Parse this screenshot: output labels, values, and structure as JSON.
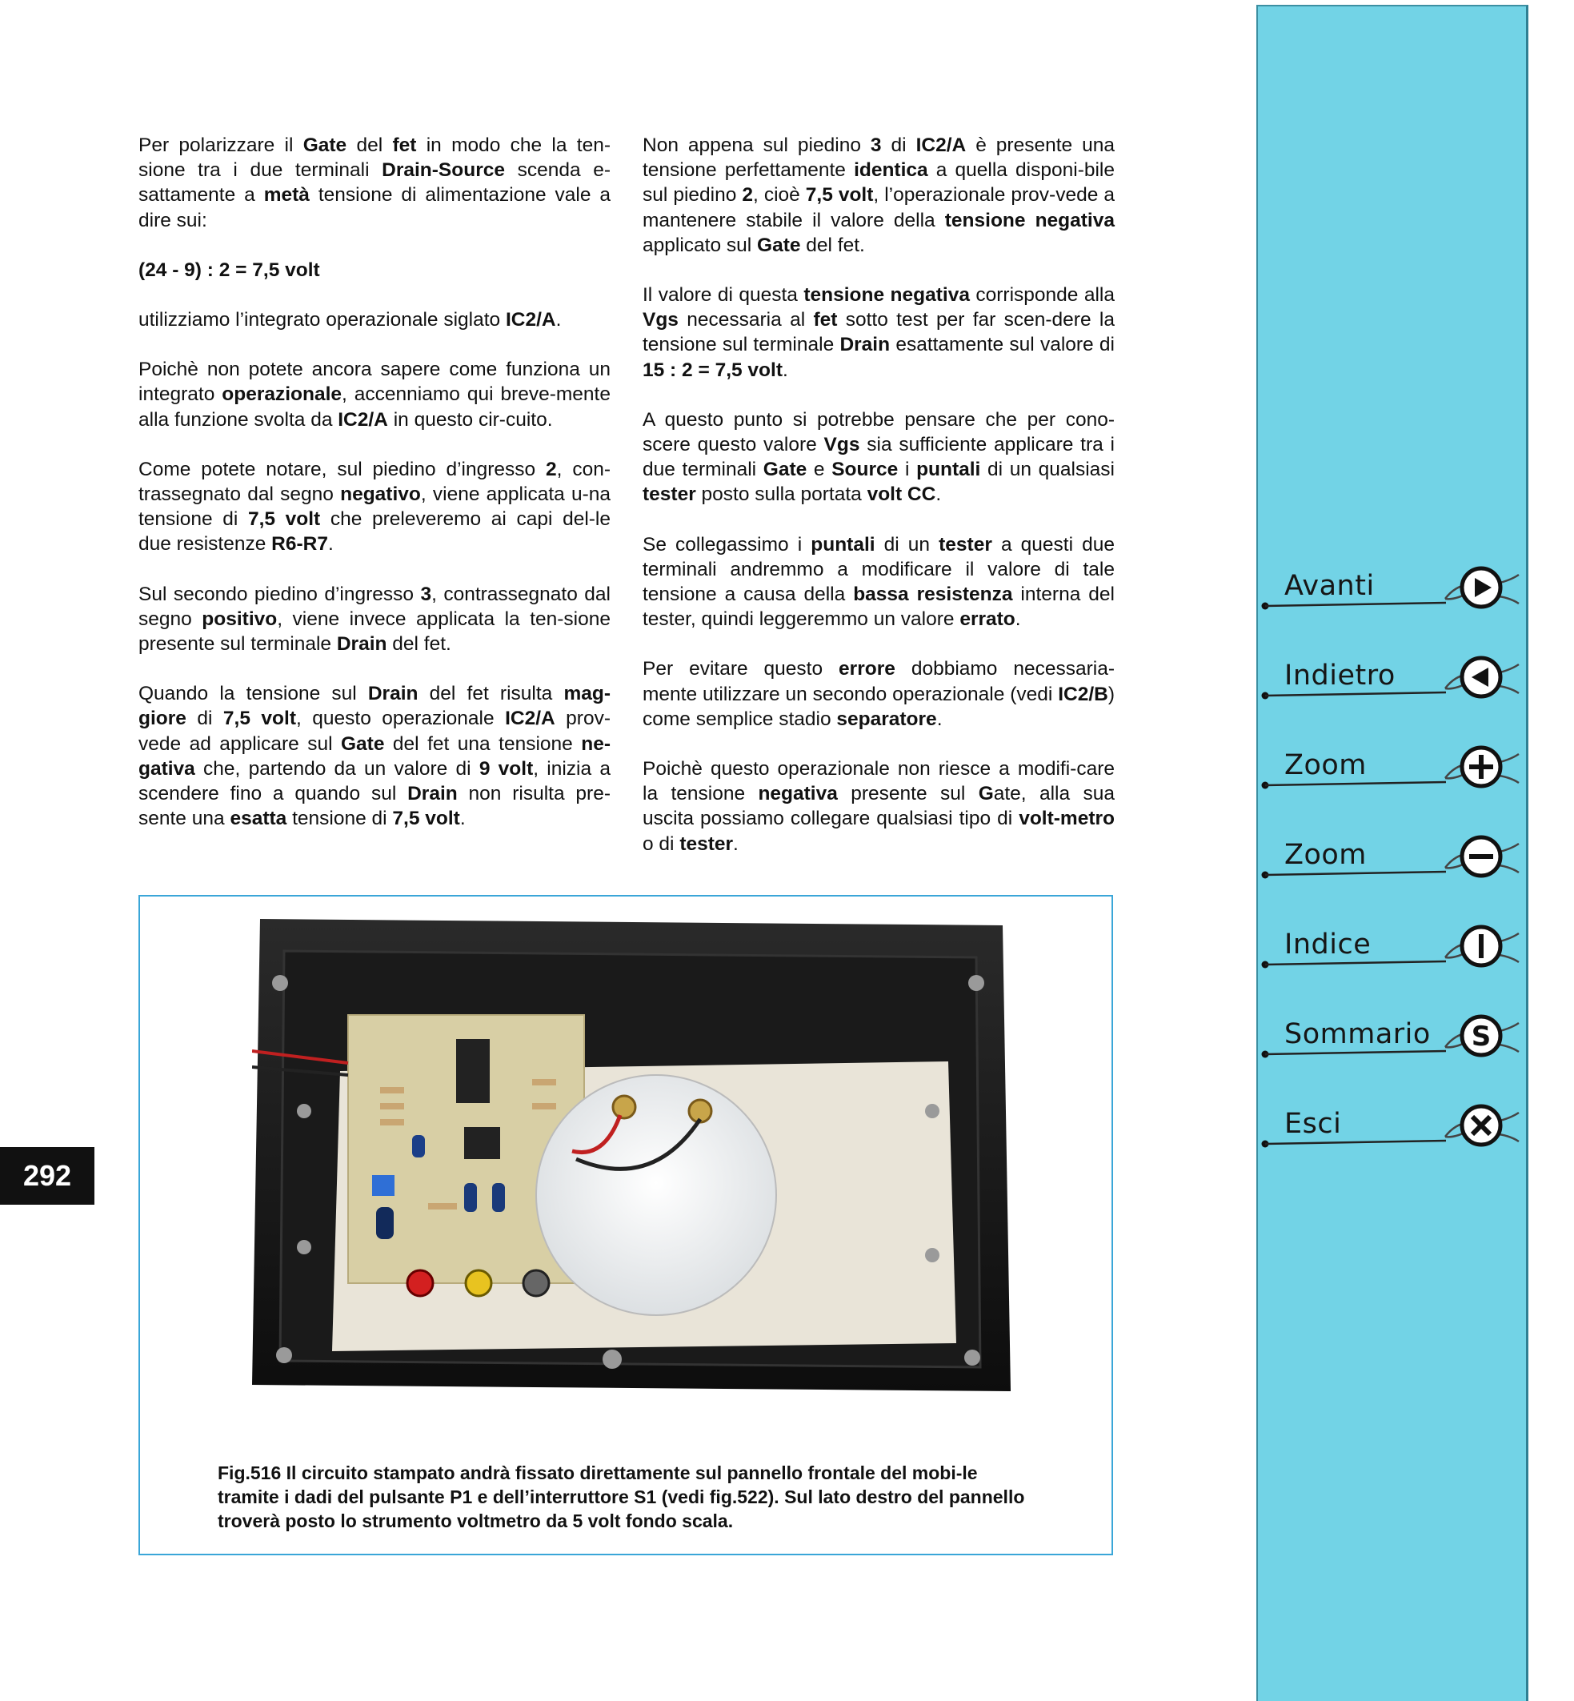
{
  "left_column": [
    "Per polarizzare il <b>Gate</b> del <b>fet</b> in modo che la ten-sione tra i due terminali <b>Drain-Source</b> scenda e-sattamente a <b>metà</b> tensione di alimentazione vale a dire sui:",
    "<b>(24 - 9) : 2 = 7,5 volt</b>",
    "utilizziamo l’integrato operazionale siglato <b>IC2/A</b>.",
    "Poichè non potete ancora sapere come funziona un integrato <b>operazionale</b>, accenniamo qui breve-mente alla funzione svolta da <b>IC2/A</b> in questo cir-cuito.",
    "Come potete notare, sul piedino d’ingresso <b>2</b>, con-trassegnato dal segno <b>negativo</b>, viene applicata u-na tensione di <b>7,5 volt</b> che preleveremo ai capi del-le due resistenze <b>R6-R7</b>.",
    "Sul secondo piedino d’ingresso <b>3</b>, contrassegnato dal segno <b>positivo</b>, viene invece applicata la ten-sione presente sul terminale <b>Drain</b> del fet.",
    "Quando la tensione sul <b>Drain</b> del fet risulta <b>mag-giore</b> di <b>7,5 volt</b>, questo operazionale <b>IC2/A</b> prov-vede ad applicare sul <b>Gate</b> del fet una tensione <b>ne-gativa</b> che, partendo da un valore di <b>9 volt</b>, inizia a scendere fino a quando sul <b>Drain</b> non risulta pre-sente una <b>esatta</b> tensione di <b>7,5 volt</b>."
  ],
  "right_column": [
    "Non appena sul piedino <b>3</b> di <b>IC2/A</b> è presente una tensione perfettamente <b>identica</b> a quella disponi-bile sul piedino <b>2</b>, cioè <b>7,5 volt</b>, l’operazionale prov-vede a mantenere stabile il valore della <b>tensione negativa</b> applicato sul <b>Gate</b> del fet.",
    "Il valore di questa <b>tensione negativa</b> corrisponde alla <b>Vgs</b> necessaria al <b>fet</b> sotto test per far scen-dere la tensione sul terminale <b>Drain</b> esattamente sul valore di <b>15 : 2 = 7,5 volt</b>.",
    "A questo punto si potrebbe pensare che per cono-scere questo valore <b>Vgs</b> sia sufficiente applicare tra i due terminali <b>Gate</b> e <b>Source</b> i <b>puntali</b> di un qualsiasi <b>tester</b> posto sulla portata <b>volt CC</b>.",
    "Se collegassimo i <b>puntali</b> di un <b>tester</b> a questi due terminali andremmo a modificare il valore di tale tensione a causa della <b>bassa resistenza</b> interna del tester, quindi leggeremmo un valore <b>errato</b>.",
    "Per evitare questo <b>errore</b> dobbiamo necessaria-mente utilizzare un secondo operazionale (vedi <b>IC2/B</b>) come semplice stadio <b>separatore</b>.",
    "Poichè questo operazionale non riesce a modifi-care la tensione <b>negativa</b> presente sul <b>G</b>ate, alla sua uscita possiamo collegare qualsiasi tipo di <b>volt-metro</b> o di <b>tester</b>."
  ],
  "figure": {
    "caption": "Fig.516 Il circuito stampato andrà fissato direttamente sul pannello frontale del mobi-le tramite i dadi del pulsante P1 e dell’interruttore S1 (vedi fig.522). Sul lato destro del pannello troverà posto lo strumento voltmetro da 5 volt fondo scala."
  },
  "page_number": "292",
  "nav": {
    "items": [
      {
        "label": "Avanti",
        "icon": "play-right-icon",
        "glyph": "▶"
      },
      {
        "label": "Indietro",
        "icon": "play-left-icon",
        "glyph": "◀"
      },
      {
        "label": "Zoom",
        "icon": "plus-icon",
        "glyph": "+"
      },
      {
        "label": "Zoom",
        "icon": "minus-icon",
        "glyph": "−"
      },
      {
        "label": "Indice",
        "icon": "index-i-icon",
        "glyph": "I"
      },
      {
        "label": "Sommario",
        "icon": "summary-s-icon",
        "glyph": "S"
      },
      {
        "label": "Esci",
        "icon": "close-x-icon",
        "glyph": "✕"
      }
    ]
  },
  "colors": {
    "nav_background": "#72d3e6",
    "figure_border": "#3aa6d8",
    "page_number_background": "#111111"
  }
}
